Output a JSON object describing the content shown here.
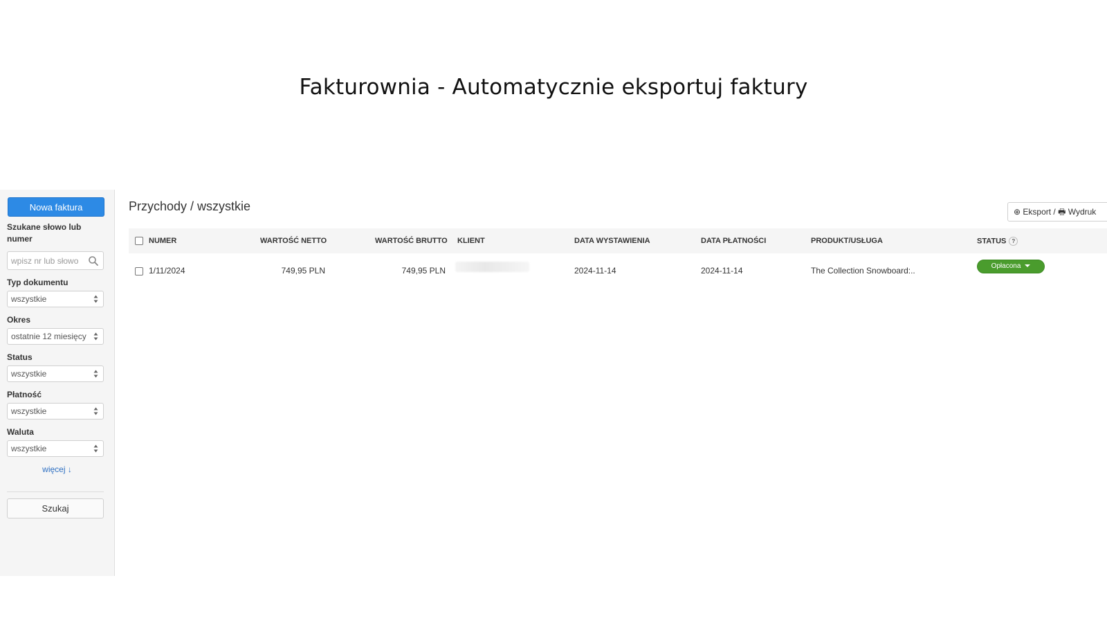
{
  "slide": {
    "title": "Fakturownia - Automatycznie eksportuj faktury"
  },
  "sidebar": {
    "new_invoice_label": "Nowa faktura",
    "search_label": "Szukane słowo lub numer",
    "search_placeholder": "wpisz nr lub słowo",
    "filters": [
      {
        "label": "Typ dokumentu",
        "value": "wszystkie"
      },
      {
        "label": "Okres",
        "value": "ostatnie 12 miesięcy"
      },
      {
        "label": "Status",
        "value": "wszystkie"
      },
      {
        "label": "Płatność",
        "value": "wszystkie"
      },
      {
        "label": "Waluta",
        "value": "wszystkie"
      }
    ],
    "more_label": "więcej ↓",
    "search_button_label": "Szukaj"
  },
  "main": {
    "title": "Przychody / wszystkie",
    "export_label": "⊕ Eksport / 🖶 Wydruk",
    "columns": [
      "NUMER",
      "WARTOŚĆ NETTO",
      "WARTOŚĆ BRUTTO",
      "KLIENT",
      "DATA WYSTAWIENIA",
      "DATA PŁATNOŚCI",
      "PRODUKT/USŁUGA",
      "STATUS"
    ],
    "status_help": "?",
    "rows": [
      {
        "number": "1/11/2024",
        "net": "749,95 PLN",
        "gross": "749,95 PLN",
        "client": "",
        "issue_date": "2024-11-14",
        "payment_date": "2024-11-14",
        "product": "The Collection Snowboard:..",
        "status": "Opłacona",
        "status_color": "#4a9c2d"
      }
    ]
  },
  "colors": {
    "primary_button": "#2d8ae5",
    "link": "#2d6fc2",
    "paid_status": "#4a9c2d"
  }
}
